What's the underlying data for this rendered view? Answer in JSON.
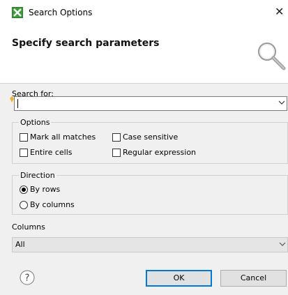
{
  "window": {
    "title": "Search Options",
    "close_glyph": "✕"
  },
  "header": {
    "title": "Specify search parameters",
    "icon": "magnifier-icon"
  },
  "search": {
    "label": "Search for:",
    "value": ""
  },
  "options": {
    "title": "Options",
    "mark_all_matches": {
      "label": "Mark all matches",
      "checked": false
    },
    "case_sensitive": {
      "label": "Case sensitive",
      "checked": false
    },
    "entire_cells": {
      "label": "Entire cells",
      "checked": false
    },
    "regular_expression": {
      "label": "Regular expression",
      "checked": false
    }
  },
  "direction": {
    "title": "Direction",
    "by_rows": {
      "label": "By rows",
      "selected": true
    },
    "by_columns": {
      "label": "By columns",
      "selected": false
    }
  },
  "columns": {
    "label": "Columns",
    "selected": "All"
  },
  "buttons": {
    "ok": "OK",
    "cancel": "Cancel",
    "help_glyph": "?"
  },
  "colors": {
    "accent": "#0078d7",
    "app_icon_green": "#3a9c3a"
  }
}
